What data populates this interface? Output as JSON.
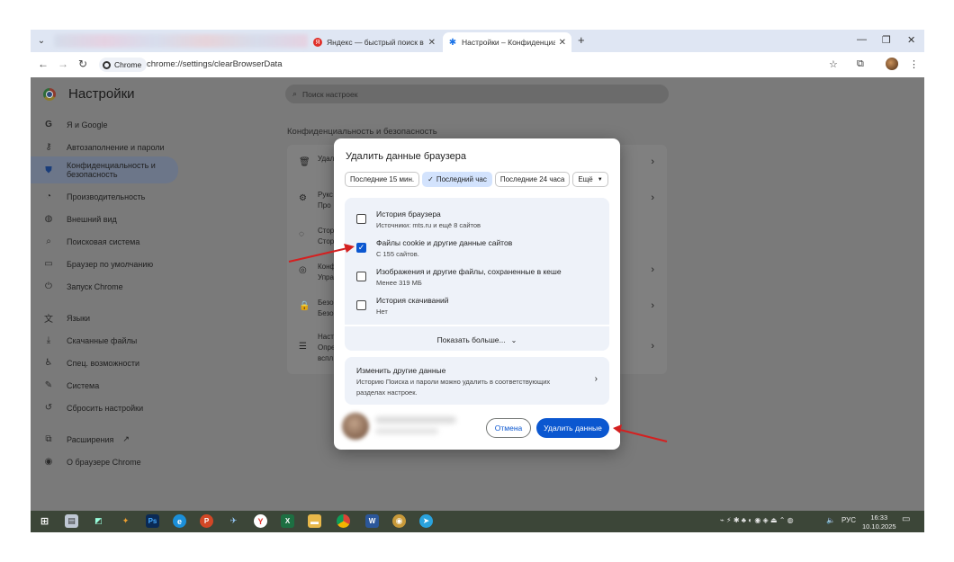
{
  "browser": {
    "tabs": [
      {
        "title": "Яндекс — быстрый поиск в и...",
        "favicon": "yandex-icon",
        "active": false
      },
      {
        "title": "Настройки – Конфиденциальн...",
        "favicon": "gear-icon",
        "active": true
      }
    ],
    "address_chip": "Chrome",
    "url": "chrome://settings/clearBrowserData"
  },
  "settings": {
    "title": "Настройки",
    "search_placeholder": "Поиск настроек",
    "sidebar": [
      {
        "label": "Я и Google",
        "icon": "google-icon"
      },
      {
        "label": "Автозаполнение и пароли",
        "icon": "key-icon"
      },
      {
        "label": "Конфиденциальность и безопасность",
        "icon": "shield-icon",
        "selected": true
      },
      {
        "label": "Производительность",
        "icon": "speedometer-icon"
      },
      {
        "label": "Внешний вид",
        "icon": "palette-icon"
      },
      {
        "label": "Поисковая система",
        "icon": "search-icon"
      },
      {
        "label": "Браузер по умолчанию",
        "icon": "browser-icon"
      },
      {
        "label": "Запуск Chrome",
        "icon": "power-icon"
      },
      {
        "label": "Языки",
        "icon": "translate-icon"
      },
      {
        "label": "Скачанные файлы",
        "icon": "download-icon"
      },
      {
        "label": "Спец. возможности",
        "icon": "accessibility-icon"
      },
      {
        "label": "Система",
        "icon": "wrench-icon"
      },
      {
        "label": "Сбросить настройки",
        "icon": "reset-icon"
      },
      {
        "label": "Расширения",
        "icon": "puzzle-icon"
      },
      {
        "label": "О браузере Chrome",
        "icon": "chrome-icon"
      }
    ],
    "section_title": "Конфиденциальность и безопасность",
    "card_rows": [
      {
        "text1": "Удал",
        "text2": "",
        "icon": "trash-icon"
      },
      {
        "text1": "Рукс",
        "text2": "Про",
        "icon": "guide-icon"
      },
      {
        "text1": "Стор",
        "text2": "Стор",
        "icon": "cookie-icon"
      },
      {
        "text1": "Конф",
        "text2": "Упра",
        "icon": "ads-icon"
      },
      {
        "text1": "Безо",
        "text2": "Безо",
        "icon": "lock-icon"
      },
      {
        "text1": "Наст",
        "text2": "Опре",
        "text3": "вспл",
        "icon": "sliders-icon"
      }
    ]
  },
  "dialog": {
    "title": "Удалить данные браузера",
    "time_ranges": [
      "Последние 15 мин.",
      "Последний час",
      "Последние 24 часа"
    ],
    "selected_time_range": "Последний час",
    "more_range": "Ещё",
    "options": [
      {
        "title": "История браузера",
        "subtitle": "Источники: mts.ru и ещё 8 сайтов",
        "checked": false
      },
      {
        "title": "Файлы cookie и другие данные сайтов",
        "subtitle": "С 155 сайтов.",
        "checked": true
      },
      {
        "title": "Изображения и другие файлы, сохраненные в кеше",
        "subtitle": "Менее 319 МБ",
        "checked": false
      },
      {
        "title": "История скачиваний",
        "subtitle": "Нет",
        "checked": false
      }
    ],
    "show_more": "Показать больше...",
    "other": {
      "title": "Изменить другие данные",
      "description": "Историю Поиска и пароли можно удалить в соответствующих разделах настроек."
    },
    "cancel_label": "Отмена",
    "delete_label": "Удалить данные"
  },
  "taskbar": {
    "language": "РУС",
    "time": "16:33",
    "date": "10.10.2025"
  },
  "colors": {
    "accent": "#0b57d0",
    "arrow": "#d42020",
    "overlay": "#7a7a7a",
    "taskbar": "#3c4638"
  }
}
